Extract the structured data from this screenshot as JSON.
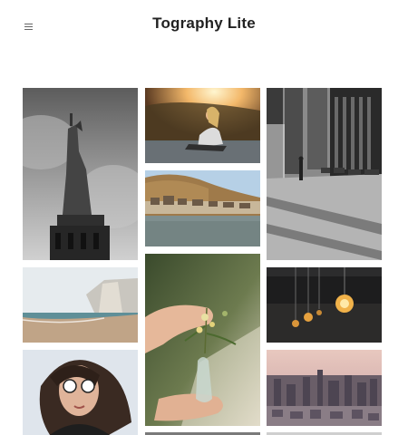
{
  "header": {
    "title": "Tography Lite",
    "menu_icon": "hamburger-menu-icon"
  },
  "gallery": {
    "photos": [
      {
        "subject": "statue-of-liberty"
      },
      {
        "subject": "woman-sitting-at-sunset-lake"
      },
      {
        "subject": "city-street-shadows"
      },
      {
        "subject": "riverside-village-under-cliffs"
      },
      {
        "subject": "sea-cliffs-beach"
      },
      {
        "subject": "hands-holding-flower-vase"
      },
      {
        "subject": "hanging-light-bulbs"
      },
      {
        "subject": "woman-with-sunglasses"
      },
      {
        "subject": "aerial-city-skyline"
      }
    ]
  }
}
